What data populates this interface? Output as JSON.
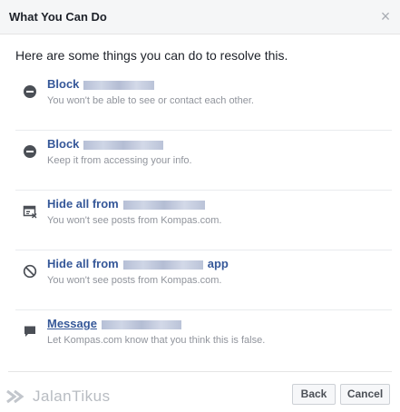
{
  "dialog": {
    "title": "What You Can Do",
    "close_glyph": "×",
    "intro": "Here are some things you can do to resolve this."
  },
  "options": [
    {
      "icon": "block-icon",
      "title": "Block",
      "suffix": "",
      "description": "You won't be able to see or contact each other."
    },
    {
      "icon": "block-icon",
      "title": "Block",
      "suffix": "",
      "description": "Keep it from accessing your info."
    },
    {
      "icon": "hide-feed-icon",
      "title": "Hide all from",
      "suffix": "",
      "description": "You won't see posts from Kompas.com."
    },
    {
      "icon": "no-entry-icon",
      "title": "Hide all from",
      "suffix": "app",
      "description": "You won't see posts from Kompas.com."
    },
    {
      "icon": "message-icon",
      "title": "Message",
      "suffix": "",
      "description": "Let Kompas.com know that you think this is false."
    }
  ],
  "footer": {
    "back_label": "Back",
    "cancel_label": "Cancel"
  },
  "watermark": {
    "text": "JalanTikus"
  },
  "colors": {
    "link": "#365899",
    "muted": "#90949c",
    "header_bg": "#f5f6f7"
  }
}
